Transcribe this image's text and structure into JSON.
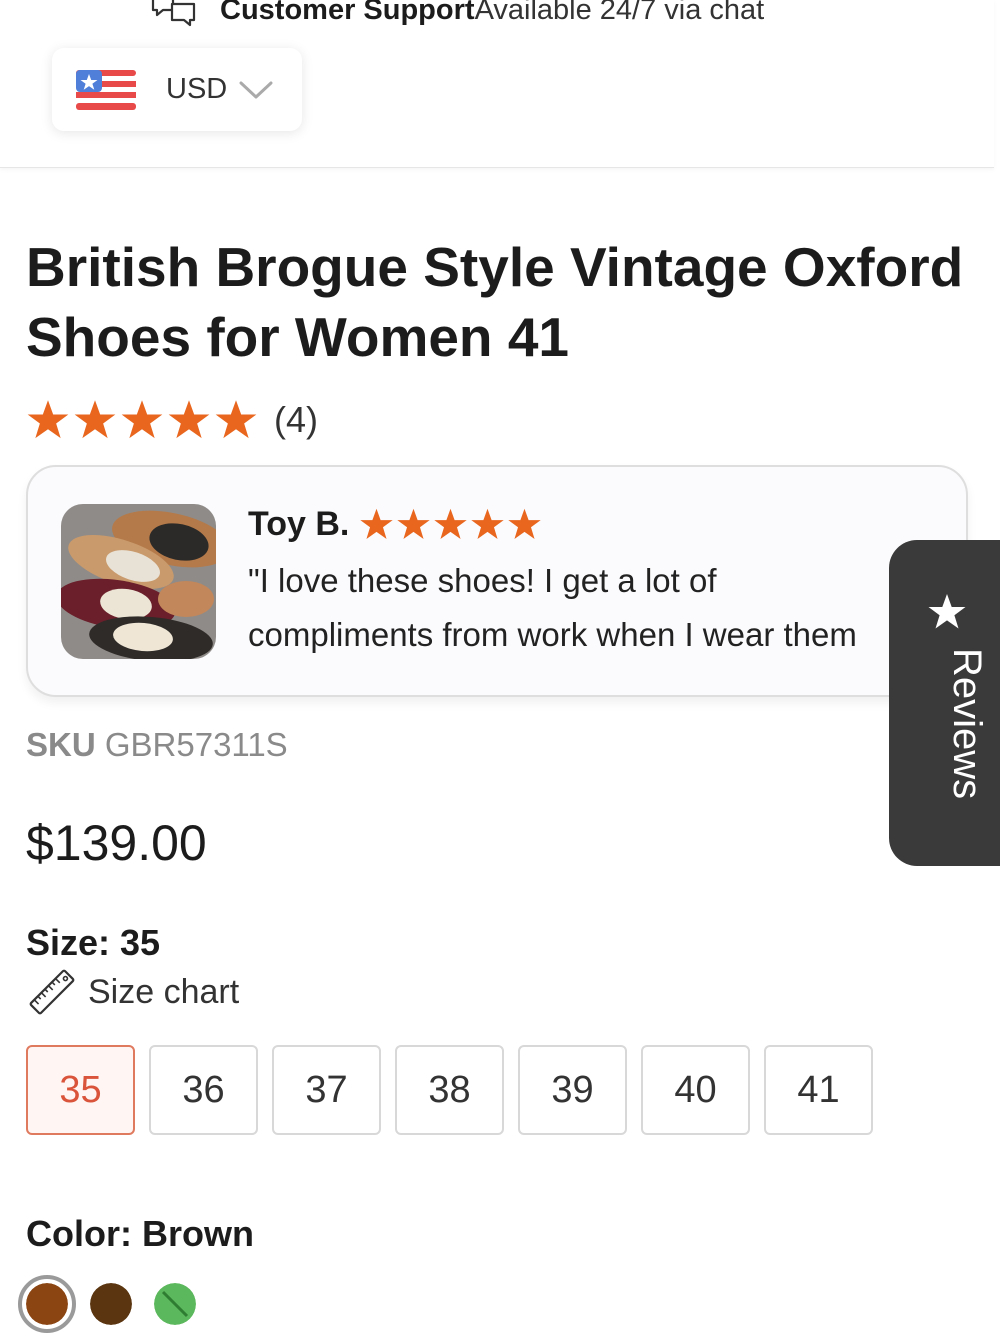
{
  "support": {
    "title": "Customer Support",
    "subtitle": "Available 24/7 via chat",
    "icon": "chat-bubbles-icon"
  },
  "currency": {
    "label": "USD",
    "flag_icon": "us-flag-icon"
  },
  "product": {
    "title": "British Brogue Style Vintage Oxford Shoes for Women 41",
    "rating": 5,
    "rating_count": "(4)",
    "sku_label": "SKU",
    "sku_value": "GBR57311S",
    "price": "$139.00"
  },
  "review": {
    "name": "Toy B.",
    "rating": 5,
    "text": "\"I love these shoes! I get a lot of",
    "text_line2": "compliments from work when I wear them"
  },
  "reviews_tab": {
    "label": "Reviews"
  },
  "size": {
    "heading": "Size: 35",
    "chart_label": "Size chart",
    "options": [
      "35",
      "36",
      "37",
      "38",
      "39",
      "40",
      "41"
    ],
    "selected": "35"
  },
  "color": {
    "heading": "Color: Brown",
    "swatches": [
      {
        "name": "Brown",
        "hex": "#8b4513",
        "selected": true
      },
      {
        "name": "Dark Brown",
        "hex": "#5a3510",
        "selected": false
      },
      {
        "name": "Green",
        "hex": "#5cb85c",
        "selected": false
      }
    ]
  },
  "colors": {
    "star": "#e8661e",
    "accent": "#d9543a",
    "tab_bg": "#3a3a3a"
  }
}
